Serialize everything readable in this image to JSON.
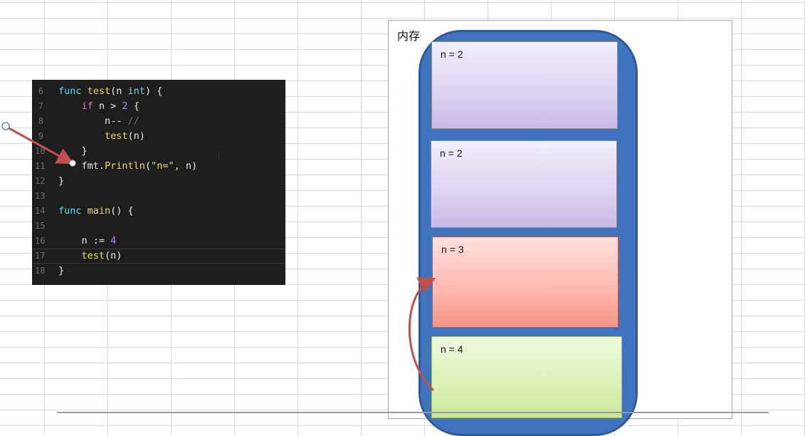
{
  "code": {
    "lines": [
      {
        "num": "6",
        "tokens": [
          {
            "t": "func ",
            "c": "kw"
          },
          {
            "t": "test",
            "c": "fn"
          },
          {
            "t": "(n ",
            "c": "punct"
          },
          {
            "t": "int",
            "c": "ty"
          },
          {
            "t": ") {",
            "c": "punct"
          }
        ]
      },
      {
        "num": "7",
        "tokens": [
          {
            "t": "    ",
            "c": "punct"
          },
          {
            "t": "if",
            "c": "kw2"
          },
          {
            "t": " n > ",
            "c": "punct"
          },
          {
            "t": "2",
            "c": "num"
          },
          {
            "t": " {",
            "c": "punct"
          }
        ]
      },
      {
        "num": "8",
        "tokens": [
          {
            "t": "        n-- ",
            "c": "punct"
          },
          {
            "t": "//",
            "c": "cm"
          }
        ]
      },
      {
        "num": "9",
        "tokens": [
          {
            "t": "        ",
            "c": "punct"
          },
          {
            "t": "test",
            "c": "fn"
          },
          {
            "t": "(n)",
            "c": "punct"
          }
        ]
      },
      {
        "num": "10",
        "tokens": [
          {
            "t": "    }",
            "c": "punct"
          }
        ]
      },
      {
        "num": "11",
        "tokens": [
          {
            "t": "    fmt.",
            "c": "punct"
          },
          {
            "t": "Println",
            "c": "fn"
          },
          {
            "t": "(",
            "c": "punct"
          },
          {
            "t": "\"n=\"",
            "c": "str"
          },
          {
            "t": ", n)",
            "c": "punct"
          }
        ]
      },
      {
        "num": "12",
        "tokens": [
          {
            "t": "}",
            "c": "punct"
          }
        ]
      },
      {
        "num": "13",
        "tokens": []
      },
      {
        "num": "14",
        "tokens": [
          {
            "t": "func ",
            "c": "kw"
          },
          {
            "t": "main",
            "c": "fn"
          },
          {
            "t": "() {",
            "c": "punct"
          }
        ]
      },
      {
        "num": "15",
        "tokens": []
      },
      {
        "num": "16",
        "tokens": [
          {
            "t": "    n := ",
            "c": "punct"
          },
          {
            "t": "4",
            "c": "num"
          }
        ]
      },
      {
        "num": "17",
        "tokens": [
          {
            "t": "    ",
            "c": "punct"
          },
          {
            "t": "test",
            "c": "fn"
          },
          {
            "t": "(n)",
            "c": "punct"
          }
        ],
        "current": true
      },
      {
        "num": "18",
        "tokens": [
          {
            "t": "}",
            "c": "punct"
          }
        ]
      }
    ]
  },
  "memory": {
    "title": "内存",
    "frames": [
      {
        "label": "n = 2",
        "color": "purple"
      },
      {
        "label": "n = 2",
        "color": "purple"
      },
      {
        "label": "n = 3",
        "color": "red"
      },
      {
        "label": "n = 4",
        "color": "green"
      }
    ]
  },
  "colors": {
    "code_background": "#1e1f1c",
    "stack_blue": "#3f73bd",
    "arrow": "#c0504d"
  }
}
